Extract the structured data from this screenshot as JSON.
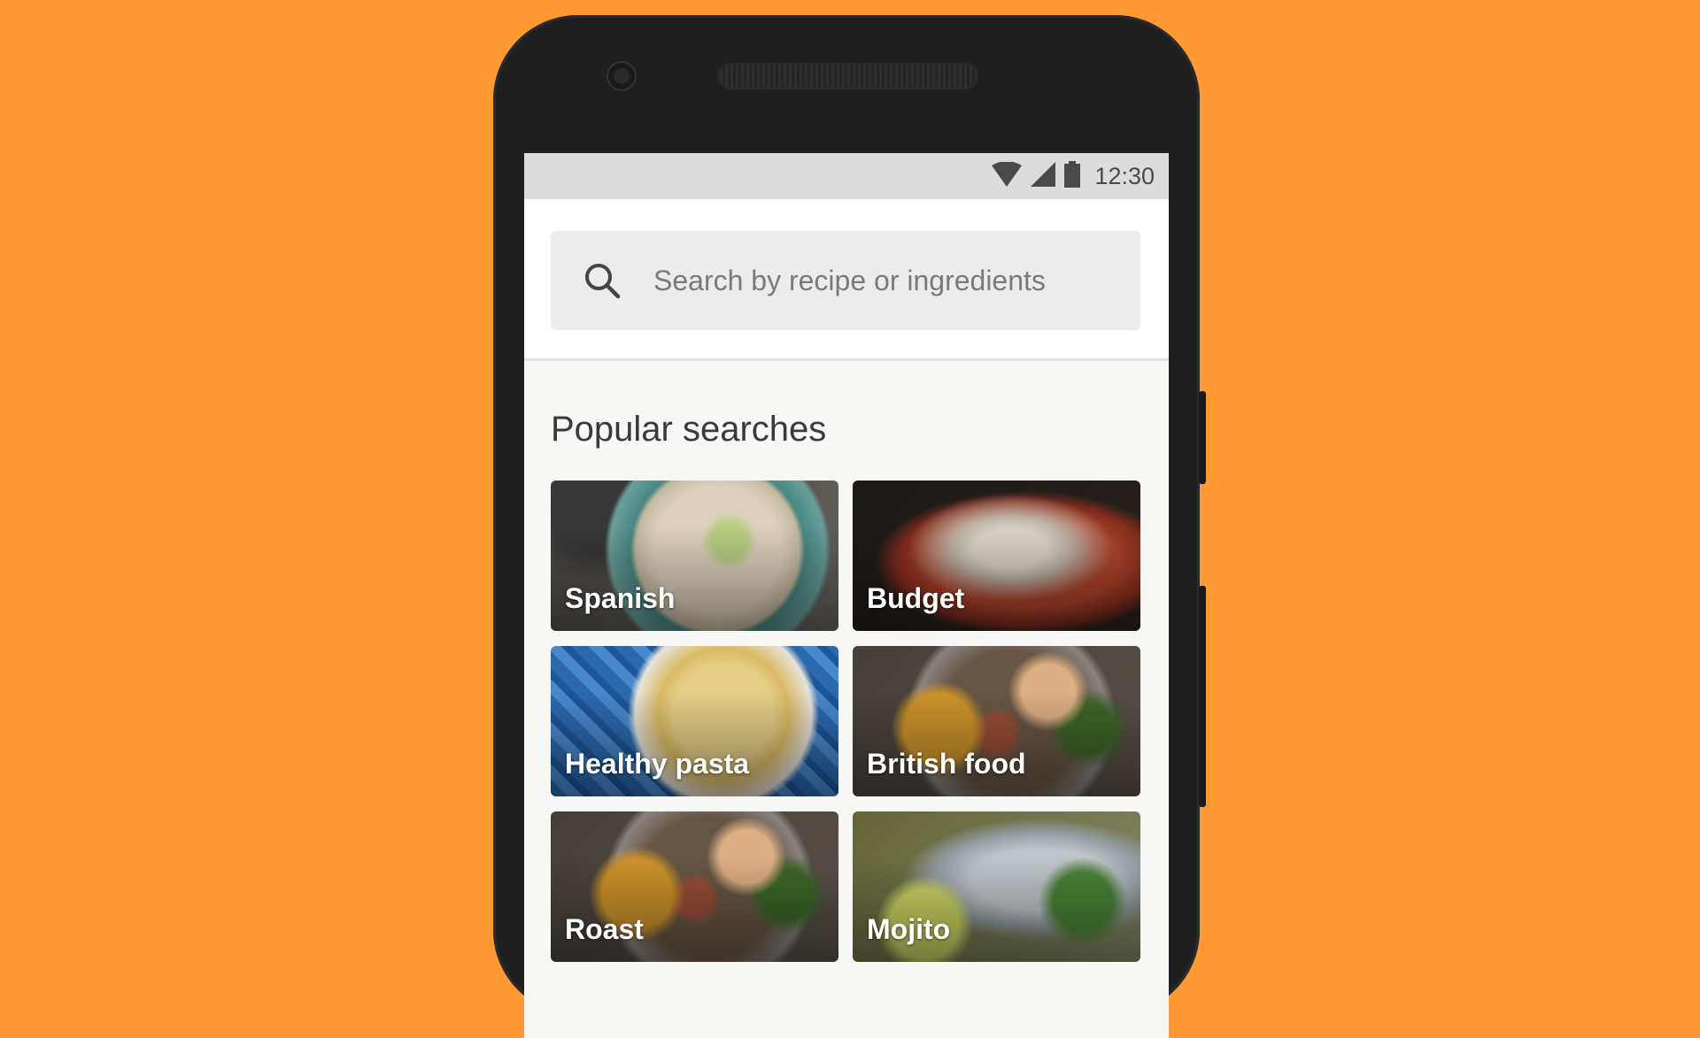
{
  "status_bar": {
    "time": "12:30",
    "icons": [
      "wifi-icon",
      "signal-icon",
      "battery-icon"
    ]
  },
  "search": {
    "placeholder": "Search by recipe or ingredients",
    "icon": "search-icon"
  },
  "popular": {
    "title": "Popular searches",
    "items": [
      {
        "label": "Spanish"
      },
      {
        "label": "Budget"
      },
      {
        "label": "Healthy pasta"
      },
      {
        "label": "British food"
      },
      {
        "label": "Roast"
      },
      {
        "label": "Mojito"
      }
    ]
  },
  "colors": {
    "background": "#FF9933",
    "phone_body": "#1f1f1f",
    "screen": "#f7f7f6",
    "search_box": "#ececec"
  }
}
